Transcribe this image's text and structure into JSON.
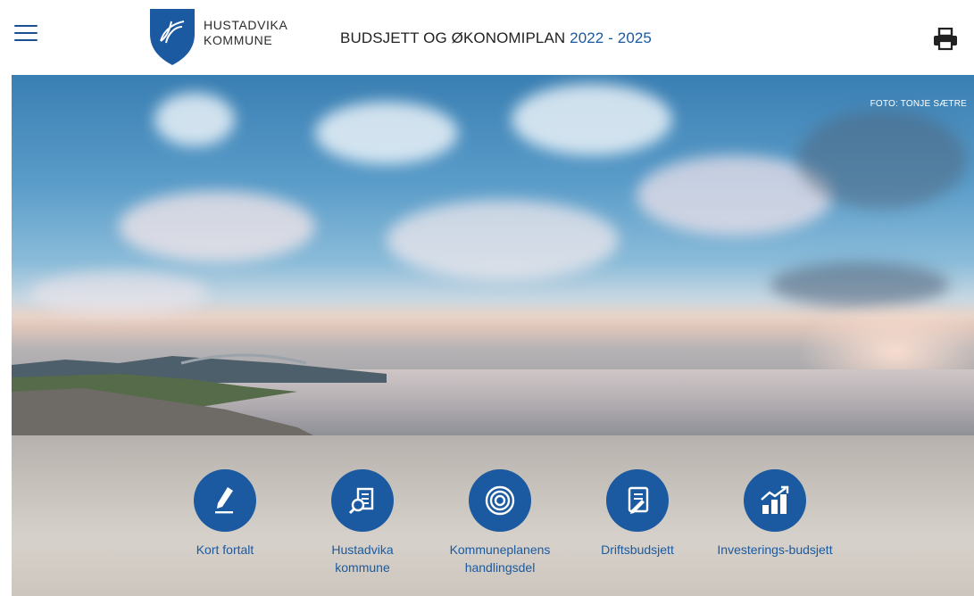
{
  "header": {
    "logo_text_line1": "HUSTADVIKA",
    "logo_text_line2": "KOMMUNE",
    "title_main": "BUDSJETT OG ØKONOMIPLAN",
    "title_years": "2022 - 2025",
    "menu_icon": "hamburger-menu-icon",
    "print_icon": "printer-icon"
  },
  "hero": {
    "photo_credit": "FOTO: TONJE SÆTRE"
  },
  "nav": {
    "items": [
      {
        "label": "Kort fortalt",
        "icon": "pencil-icon"
      },
      {
        "label": "Hustadvika kommune",
        "icon": "document-search-icon"
      },
      {
        "label": "Kommuneplanens handlingsdel",
        "icon": "target-icon"
      },
      {
        "label": "Driftsbudsjett",
        "icon": "budget-document-icon"
      },
      {
        "label": "Investerings-budsjett",
        "icon": "growth-chart-icon"
      }
    ]
  },
  "colors": {
    "brand_blue": "#1b5aa0",
    "header_bg": "#ffffff"
  }
}
